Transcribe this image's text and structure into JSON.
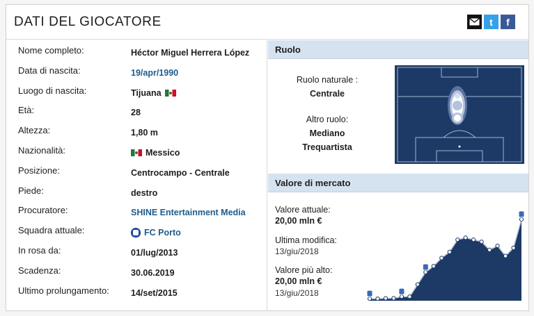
{
  "title": "DATI DEL GIOCATORE",
  "share": {
    "email_icon": "email-icon",
    "twitter_icon": "twitter-icon",
    "facebook_icon": "facebook-icon",
    "twitter_glyph": "t",
    "facebook_glyph": "f"
  },
  "colors": {
    "accent": "#1d5c8c",
    "section_header": "#d5e2ef",
    "field": "#1d3a66"
  },
  "details": [
    {
      "label": "Nome completo:",
      "value": "Héctor Miguel Herrera López"
    },
    {
      "label": "Data di nascita:",
      "value": "19/apr/1990",
      "link": true
    },
    {
      "label": "Luogo di nascita:",
      "value": "Tijuana",
      "flag_after": true
    },
    {
      "label": "Età:",
      "value": "28"
    },
    {
      "label": "Altezza:",
      "value": "1,80 m"
    },
    {
      "label": "Nazionalità:",
      "value": "Messico",
      "flag_before": true
    },
    {
      "label": "Posizione:",
      "value": "Centrocampo - Centrale"
    },
    {
      "label": "Piede:",
      "value": "destro"
    },
    {
      "label": "Procuratore:",
      "value": "SHINE Entertainment Media",
      "link": true
    },
    {
      "label": "Squadra attuale:",
      "value": "FC Porto",
      "link": true,
      "club_icon": true
    },
    {
      "label": "In rosa da:",
      "value": "01/lug/2013"
    },
    {
      "label": "Scadenza:",
      "value": "30.06.2019"
    },
    {
      "label": "Ultimo prolungamento:",
      "value": "14/set/2015"
    }
  ],
  "ruolo": {
    "heading": "Ruolo",
    "natural_label": "Ruolo naturale :",
    "natural_value": "Centrale",
    "other_label": "Altro ruolo:",
    "other_values": [
      "Mediano",
      "Trequartista"
    ]
  },
  "valore": {
    "heading": "Valore di mercato",
    "current_label": "Valore attuale:",
    "current_value": "20,00 mln €",
    "last_change_label": "Ultima modifica:",
    "last_change_value": "13/giu/2018",
    "highest_label": "Valore più alto:",
    "highest_value": "20,00 mln €",
    "highest_date": "13/giu/2018"
  },
  "chart_data": {
    "type": "area",
    "title": "",
    "xlabel": "",
    "ylabel": "",
    "values": [
      0.5,
      0.5,
      0.6,
      0.6,
      1.0,
      1.0,
      4.0,
      7.0,
      8.5,
      10.5,
      12.0,
      15.0,
      15.5,
      15.0,
      14.5,
      12.5,
      13.5,
      11.0,
      13.0,
      20.0
    ],
    "ylim": [
      0,
      21
    ],
    "club_markers_at": [
      0,
      4,
      7,
      19
    ],
    "grid": false,
    "legend": "none"
  }
}
